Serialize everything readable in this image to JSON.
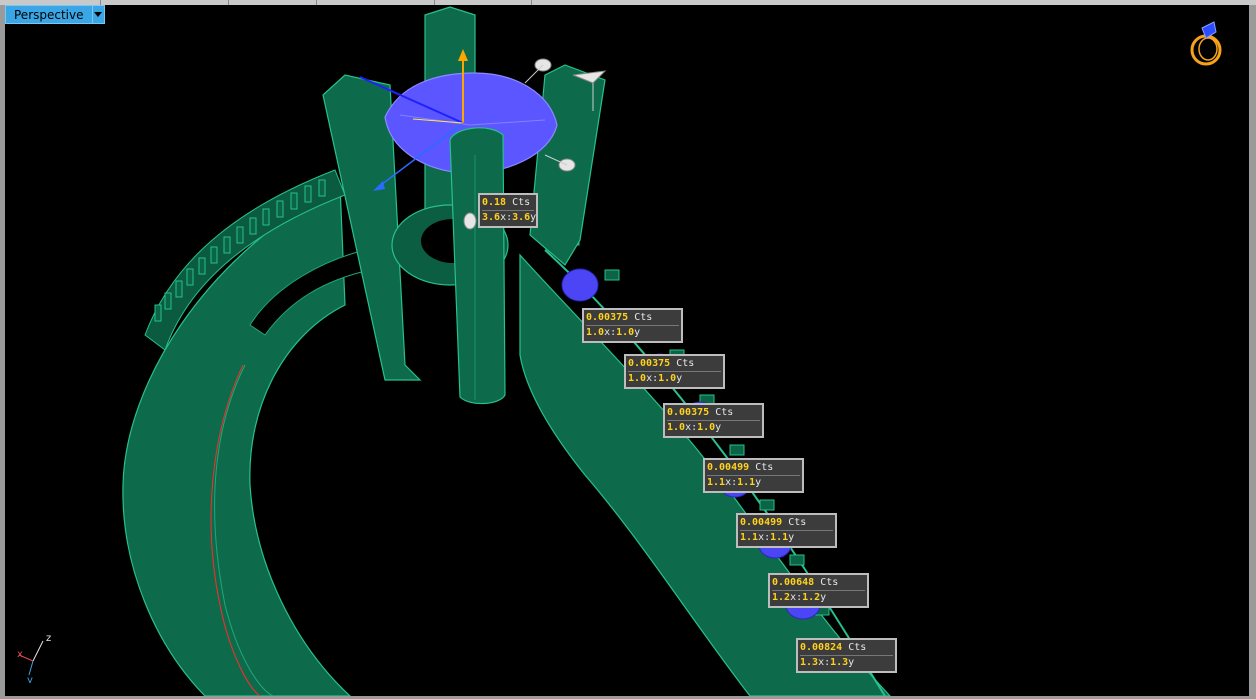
{
  "viewport": {
    "menu_label": "Perspective",
    "background": "#000000",
    "accent": "#3aa6e6"
  },
  "icons": {
    "dropdown": "chevron-down-icon",
    "ring_view": "ring-icon",
    "axis": "axis-triad-icon"
  },
  "axis_labels": {
    "x": "x",
    "y": "y",
    "z": "z"
  },
  "colors": {
    "ring": "#0d6b4c",
    "stone": "#5b56ff",
    "tag_value": "#ffd21c"
  },
  "stone_tags": [
    {
      "weight": "0.18",
      "unit": "Cts",
      "w": "3.6",
      "h": "3.6"
    },
    {
      "weight": "0.00375",
      "unit": "Cts",
      "w": "1.0",
      "h": "1.0"
    },
    {
      "weight": "0.00375",
      "unit": "Cts",
      "w": "1.0",
      "h": "1.0"
    },
    {
      "weight": "0.00375",
      "unit": "Cts",
      "w": "1.0",
      "h": "1.0"
    },
    {
      "weight": "0.00499",
      "unit": "Cts",
      "w": "1.1",
      "h": "1.1"
    },
    {
      "weight": "0.00499",
      "unit": "Cts",
      "w": "1.1",
      "h": "1.1"
    },
    {
      "weight": "0.00648",
      "unit": "Cts",
      "w": "1.2",
      "h": "1.2"
    },
    {
      "weight": "0.00824",
      "unit": "Cts",
      "w": "1.3",
      "h": "1.3"
    }
  ]
}
